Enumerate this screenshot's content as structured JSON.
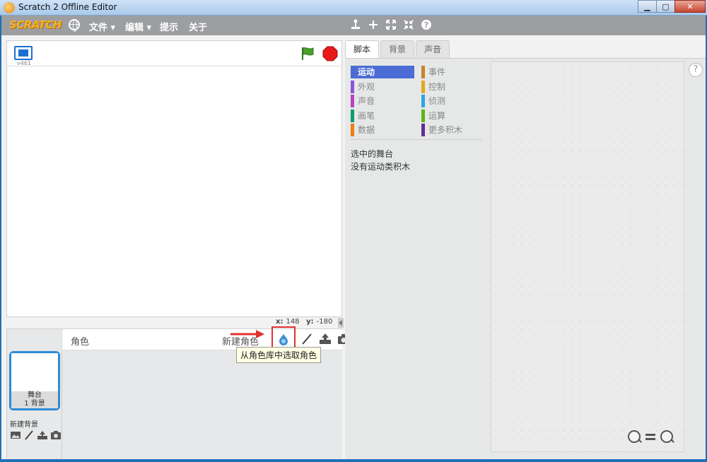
{
  "window": {
    "title": "Scratch 2 Offline Editor",
    "controls": {
      "minimize": "▁",
      "maximize": "▢",
      "close": "✕"
    }
  },
  "menubar": {
    "logo": "SCRATCH",
    "items": [
      "文件 ▾",
      "编辑 ▾",
      "提示",
      "关于"
    ],
    "tools": [
      "duplicate-icon",
      "delete-icon",
      "grow-icon",
      "shrink-icon",
      "help-icon"
    ]
  },
  "stage": {
    "version": "v461",
    "coords": {
      "x_label": "x:",
      "x_value": "148",
      "y_label": "y:",
      "y_value": "-180"
    }
  },
  "sprites": {
    "title": "角色",
    "new_sprite_label": "新建角色",
    "tooltip": "从角色库中选取角色",
    "stage_thumb": {
      "name": "舞台",
      "backdrops": "1 背景"
    },
    "new_backdrop_label": "新建背景"
  },
  "tabs": [
    "脚本",
    "背景",
    "声音"
  ],
  "palette": {
    "categories_left": [
      {
        "label": "运动",
        "color": "#4a6cd4",
        "active": true
      },
      {
        "label": "外观",
        "color": "#8a55d7",
        "active": false
      },
      {
        "label": "声音",
        "color": "#bb42c3",
        "active": false
      },
      {
        "label": "画笔",
        "color": "#0e9a6c",
        "active": false
      },
      {
        "label": "数据",
        "color": "#ee7d16",
        "active": false
      }
    ],
    "categories_right": [
      {
        "label": "事件",
        "color": "#c88330",
        "active": false
      },
      {
        "label": "控制",
        "color": "#e1a91a",
        "active": false
      },
      {
        "label": "侦测",
        "color": "#2ca5e2",
        "active": false
      },
      {
        "label": "运算",
        "color": "#5cb712",
        "active": false
      },
      {
        "label": "更多积木",
        "color": "#632d99",
        "active": false
      }
    ],
    "note_line1": "选中的舞台",
    "note_line2": "没有运动类积木"
  },
  "script_area": {
    "help": "?"
  }
}
